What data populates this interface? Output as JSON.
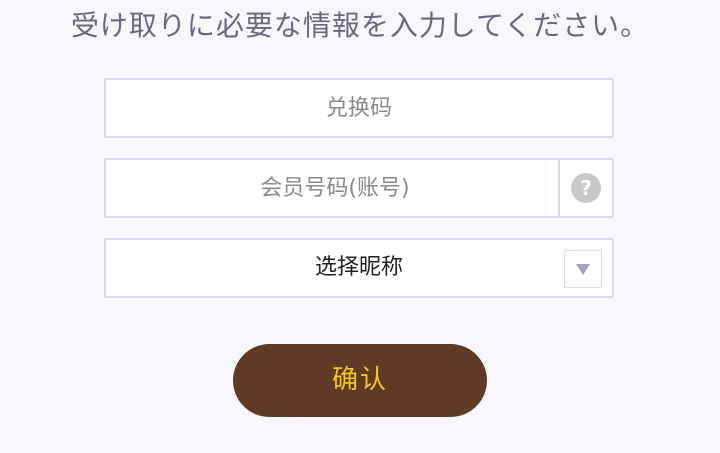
{
  "instruction": "受け取りに必要な情報を入力してください。",
  "form": {
    "code": {
      "value": "",
      "placeholder": "兑换码"
    },
    "member": {
      "value": "",
      "placeholder": "会员号码(账号)",
      "help_glyph": "?"
    },
    "nickname": {
      "selected_label": "选择昵称"
    },
    "confirm_label": "确认"
  },
  "colors": {
    "background": "#f8f7fb",
    "border": "#dcd7ec",
    "button_bg": "#5f3a24",
    "button_text": "#f3c62a",
    "help_icon": "#c8c8c8"
  },
  "icons": {
    "help": "question-circle-icon",
    "dropdown": "triangle-down-icon"
  }
}
